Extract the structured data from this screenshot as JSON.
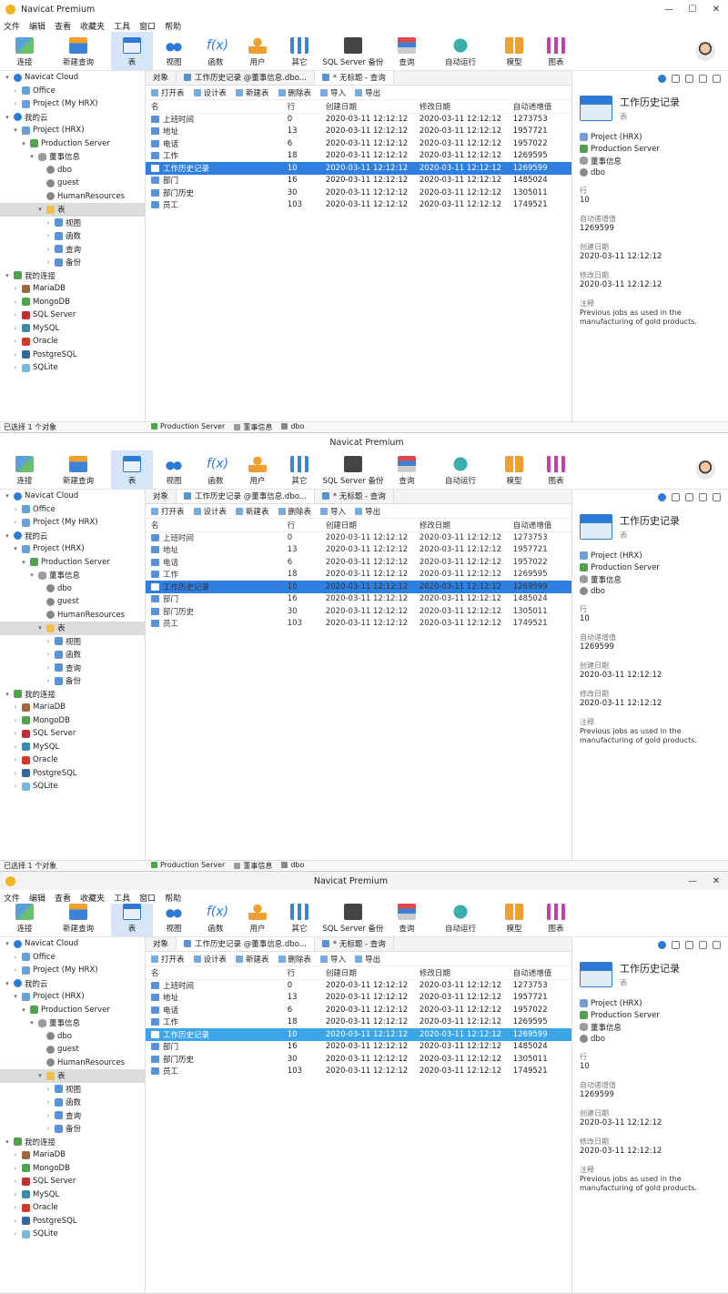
{
  "app_title": "Navicat Premium",
  "menu": [
    "文件",
    "编辑",
    "查看",
    "收藏夹",
    "工具",
    "窗口",
    "帮助"
  ],
  "toolbar": [
    {
      "label": "连接",
      "icon": "connection-icon"
    },
    {
      "label": "新建查询",
      "icon": "new-query-icon"
    },
    {
      "label": "表",
      "icon": "table-icon"
    },
    {
      "label": "视图",
      "icon": "view-icon"
    },
    {
      "label": "函数",
      "icon": "function-icon"
    },
    {
      "label": "用户",
      "icon": "user-icon"
    },
    {
      "label": "其它",
      "icon": "other-icon"
    },
    {
      "label": "SQL Server 备份",
      "icon": "backup-icon"
    },
    {
      "label": "查询",
      "icon": "query-icon"
    },
    {
      "label": "自动运行",
      "icon": "automation-icon"
    },
    {
      "label": "模型",
      "icon": "model-icon"
    },
    {
      "label": "图表",
      "icon": "chart-icon"
    }
  ],
  "nav": [
    {
      "label": "Navicat Cloud",
      "depth": 0,
      "arrow": "▾",
      "icon": "ni-cloud"
    },
    {
      "label": "Office",
      "depth": 1,
      "arrow": "›",
      "icon": "ni-proj"
    },
    {
      "label": "Project (My HRX)",
      "depth": 1,
      "arrow": "›",
      "icon": "ni-proj"
    },
    {
      "label": "我的云",
      "depth": 0,
      "arrow": "▾",
      "icon": "ni-cloud"
    },
    {
      "label": "Project (HRX)",
      "depth": 1,
      "arrow": "▾",
      "icon": "ni-proj"
    },
    {
      "label": "Production Server",
      "depth": 2,
      "arrow": "▾",
      "icon": "ni-conn"
    },
    {
      "label": "董事信息",
      "depth": 3,
      "arrow": "▾",
      "icon": "ni-db"
    },
    {
      "label": "dbo",
      "depth": 4,
      "arrow": "",
      "icon": "ni-user"
    },
    {
      "label": "guest",
      "depth": 4,
      "arrow": "",
      "icon": "ni-user"
    },
    {
      "label": "HumanResources",
      "depth": 4,
      "arrow": "",
      "icon": "ni-user"
    },
    {
      "label": "表",
      "depth": 4,
      "arrow": "▾",
      "icon": "ni-folder",
      "sel": true
    },
    {
      "label": "视图",
      "depth": 5,
      "arrow": "›",
      "icon": "ni-table"
    },
    {
      "label": "函数",
      "depth": 5,
      "arrow": "›",
      "icon": "ni-table"
    },
    {
      "label": "查询",
      "depth": 5,
      "arrow": "›",
      "icon": "ni-table"
    },
    {
      "label": "备份",
      "depth": 5,
      "arrow": "›",
      "icon": "ni-table"
    },
    {
      "label": "我的连接",
      "depth": 0,
      "arrow": "▾",
      "icon": "ni-conn"
    },
    {
      "label": "MariaDB",
      "depth": 1,
      "arrow": "›",
      "icon": "ni-maria"
    },
    {
      "label": "MongoDB",
      "depth": 1,
      "arrow": "›",
      "icon": "ni-mongo"
    },
    {
      "label": "SQL Server",
      "depth": 1,
      "arrow": "›",
      "icon": "ni-mssql"
    },
    {
      "label": "MySQL",
      "depth": 1,
      "arrow": "›",
      "icon": "ni-mysql"
    },
    {
      "label": "Oracle",
      "depth": 1,
      "arrow": "›",
      "icon": "ni-oracle"
    },
    {
      "label": "PostgreSQL",
      "depth": 1,
      "arrow": "›",
      "icon": "ni-pg"
    },
    {
      "label": "SQLite",
      "depth": 1,
      "arrow": "›",
      "icon": "ni-sqlite"
    }
  ],
  "tabs": [
    "对象",
    "工作历史记录 @董事信息.dbo...",
    "* 无标题 - 查询"
  ],
  "objbar": [
    "打开表",
    "设计表",
    "新建表",
    "删除表",
    "导入",
    "导出"
  ],
  "columns": [
    "名",
    "行",
    "创建日期",
    "修改日期",
    "自动递增值"
  ],
  "rows": [
    {
      "name": "上班时间",
      "rows": "0",
      "created": "2020-03-11 12:12:12",
      "modified": "2020-03-11 12:12:12",
      "auto": "1273753"
    },
    {
      "name": "地址",
      "rows": "13",
      "created": "2020-03-11 12:12:12",
      "modified": "2020-03-11 12:12:12",
      "auto": "1957721"
    },
    {
      "name": "电话",
      "rows": "6",
      "created": "2020-03-11 12:12:12",
      "modified": "2020-03-11 12:12:12",
      "auto": "1957022"
    },
    {
      "name": "工作",
      "rows": "18",
      "created": "2020-03-11 12:12:12",
      "modified": "2020-03-11 12:12:12",
      "auto": "1269595"
    },
    {
      "name": "工作历史记录",
      "rows": "10",
      "created": "2020-03-11 12:12:12",
      "modified": "2020-03-11 12:12:12",
      "auto": "1269599",
      "sel": true
    },
    {
      "name": "部门",
      "rows": "16",
      "created": "2020-03-11 12:12:12",
      "modified": "2020-03-11 12:12:12",
      "auto": "1485024"
    },
    {
      "name": "部门历史",
      "rows": "30",
      "created": "2020-03-11 12:12:12",
      "modified": "2020-03-11 12:12:12",
      "auto": "1305011"
    },
    {
      "name": "员工",
      "rows": "103",
      "created": "2020-03-11 12:12:12",
      "modified": "2020-03-11 12:12:12",
      "auto": "1749521"
    }
  ],
  "info": {
    "table_name": "工作历史记录",
    "table_type": "表",
    "project": "Project (HRX)",
    "connection": "Production Server",
    "database": "董事信息",
    "schema": "dbo",
    "rows_label": "行",
    "rows_value": "10",
    "engine_label": "自动递增值",
    "engine_value": "1269599",
    "created_label": "创建日期",
    "created_value": "2020-03-11 12:12:12",
    "modified_label": "修改日期",
    "modified_value": "2020-03-11 12:12:12",
    "comment_label": "注释",
    "comment_value": "Previous jobs as used in the manufacturing of gold products."
  },
  "status": {
    "left": "已选择 1 个对象",
    "conn": "Production Server",
    "db": "董事信息",
    "schema": "dbo"
  },
  "colors": {
    "accent": "#2f7fe0",
    "selection_light": "#3aa6e8"
  }
}
